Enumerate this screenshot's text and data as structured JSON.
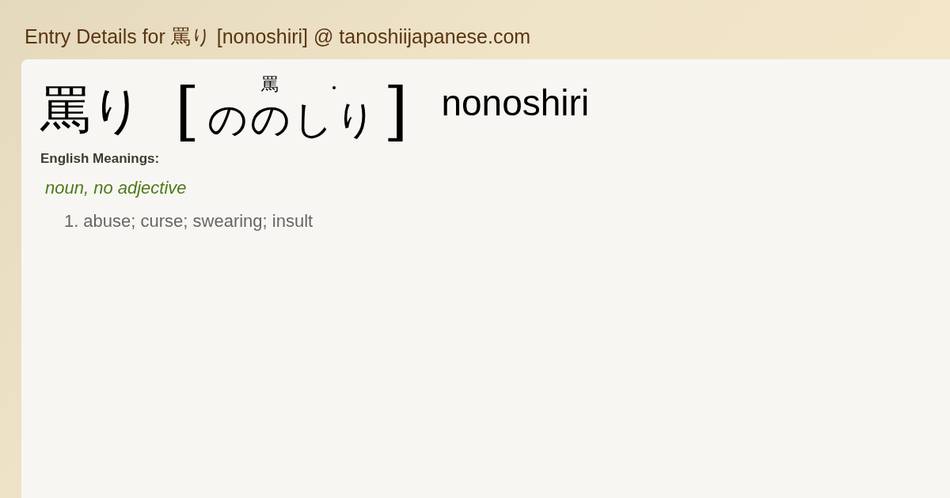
{
  "page_title": "Entry Details for 罵り [nonoshiri] @ tanoshiijapanese.com",
  "entry": {
    "word": "罵り",
    "bracket_open": "[",
    "bracket_close": "]",
    "reading": [
      {
        "char": "の",
        "accent": false
      },
      {
        "char": "の",
        "kanji": "罵",
        "accent": false
      },
      {
        "char": "し",
        "accent": true
      },
      {
        "char": "り",
        "accent": false
      }
    ],
    "romaji": "nonoshiri"
  },
  "meanings_label": "English Meanings:",
  "part_of_speech": "noun, no adjective",
  "meanings": [
    {
      "number": "1.",
      "text": "abuse; curse; swearing; insult"
    }
  ]
}
